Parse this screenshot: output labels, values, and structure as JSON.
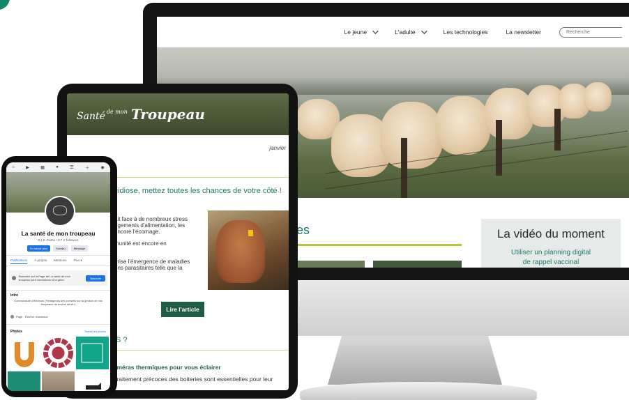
{
  "monitor": {
    "nav": {
      "items": [
        {
          "label": "Le jeune",
          "has_dropdown": true
        },
        {
          "label": "L'adulte",
          "has_dropdown": true
        },
        {
          "label": "Les technologies",
          "has_dropdown": false
        },
        {
          "label": "La newsletter",
          "has_dropdown": false
        }
      ],
      "search_placeholder": "Recherche"
    },
    "section_title_fragment": "es",
    "video": {
      "title": "La vidéo du moment",
      "link_line1": "Utiliser un planning digital",
      "link_line2": "de rappel vaccinal"
    },
    "accent_color": "#b9c33a",
    "brand_green": "#1d7a6a"
  },
  "tablet": {
    "logo": {
      "part1": "Santé",
      "part2": "de mon",
      "part3": "Troupeau"
    },
    "date": "janvier",
    "section1_fragment": "s",
    "article_title": "ccidiose, mettez toutes les chances de votre côté !",
    "article_lines": [
      "ait face à de nombreux stress",
      "ngements d'alimentation, les",
      "encore l'écornage.",
      "",
      "munité est encore en",
      "",
      "",
      "orise l'émergence de maladies",
      "ons parasitaires telle que la"
    ],
    "read_button": "Lire l'article",
    "section2_fragment": "US ?",
    "sub_title": "caméras thermiques pour vous éclairer",
    "sub_text": "e traitement précoces des boiteries sont essentielles pour leur"
  },
  "phone": {
    "page_name": "La santé de mon troupeau",
    "stats": "8,1 K J'aime • 8,7 K followers",
    "actions": [
      {
        "label": "En savoir plus",
        "primary": true
      },
      {
        "label": "Suivi(e)",
        "primary": false
      },
      {
        "label": "Message",
        "primary": false
      }
    ],
    "tabs": [
      "Publications",
      "À propos",
      "Mentions",
      "Plus ▾"
    ],
    "notice_text": "Basculez sur la Page de La santé de mon troupeau pour commencer à la gérer.",
    "notice_button": "Basculer",
    "intro_heading": "Intro",
    "intro_text": "Communauté d'éleveurs. Partageons des conseils sur la gestion de vos troupeaux de bovins lait et v",
    "page_category": "Page · Éleveur d'animaux",
    "photos_heading": "Photos",
    "photos_link": "Toutes les photos"
  }
}
